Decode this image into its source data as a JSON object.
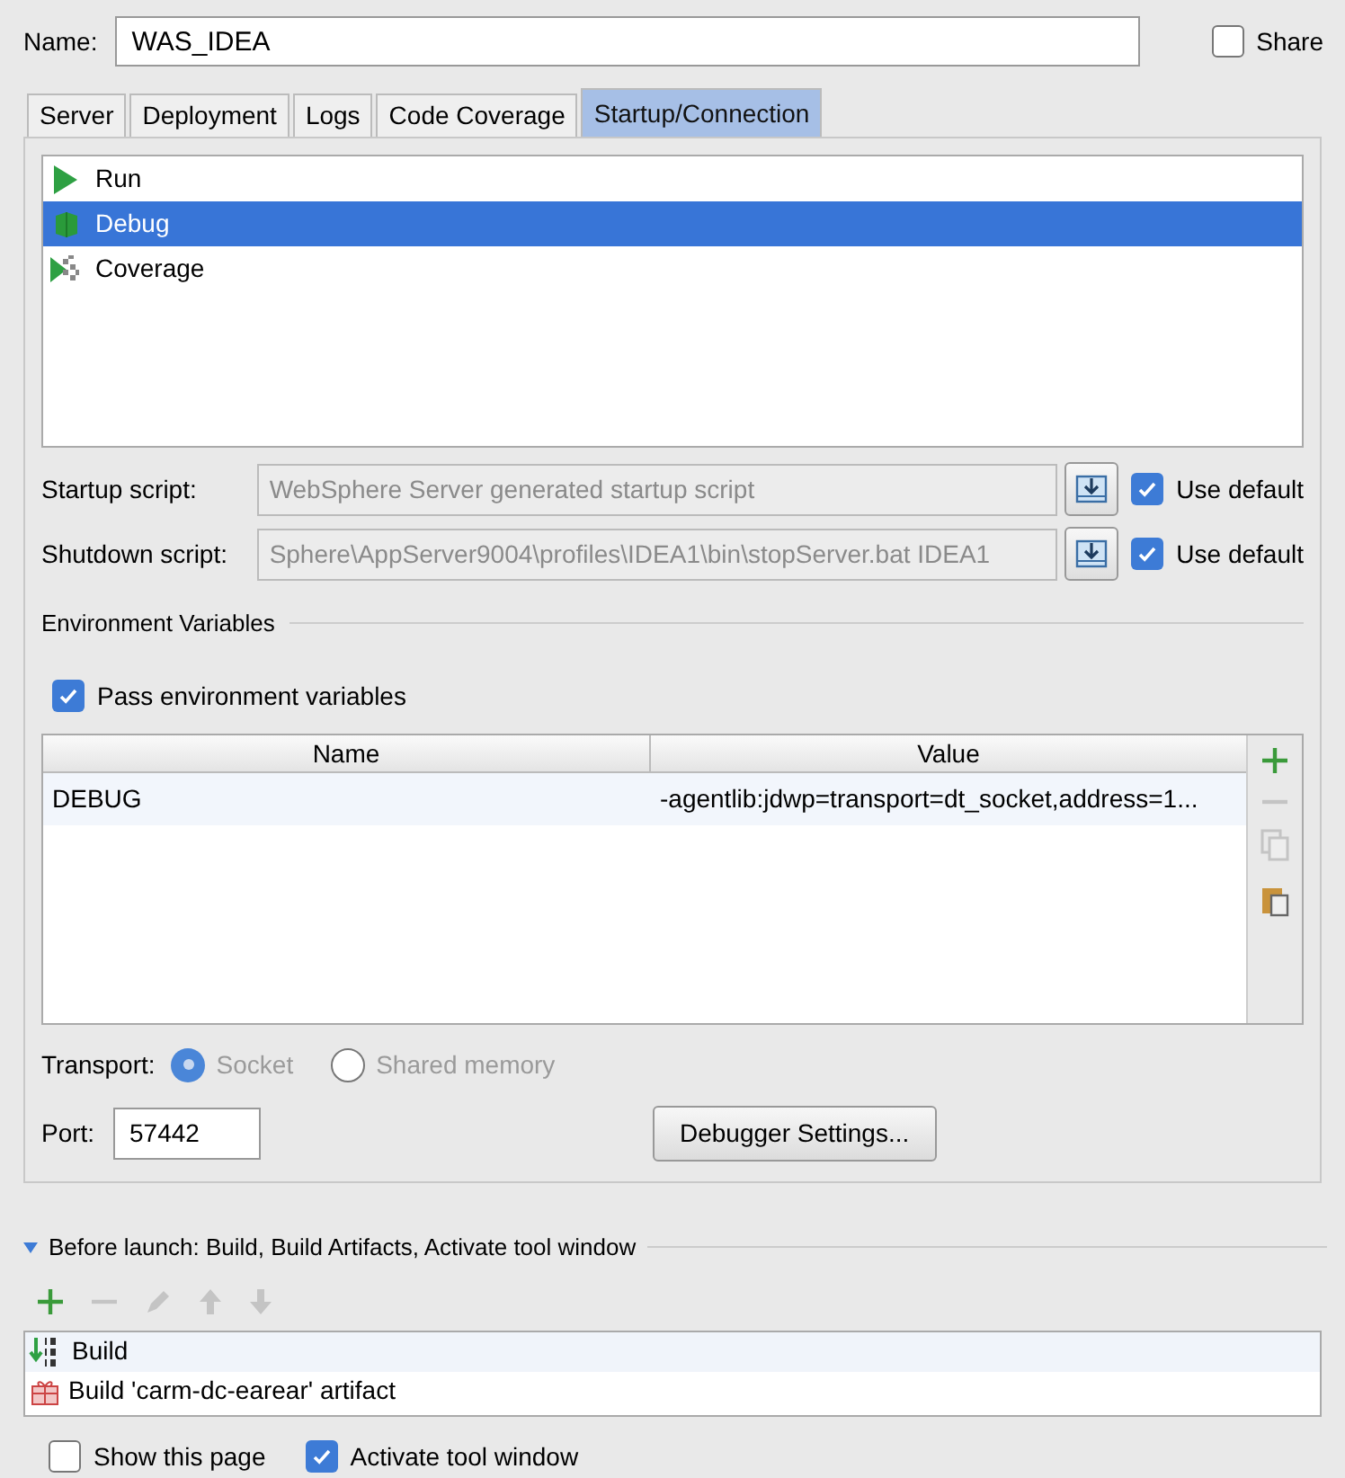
{
  "name_field": {
    "label": "Name:",
    "value": "WAS_IDEA"
  },
  "share": {
    "label": "Share",
    "checked": false
  },
  "tabs": [
    {
      "label": "Server",
      "selected": false
    },
    {
      "label": "Deployment",
      "selected": false
    },
    {
      "label": "Logs",
      "selected": false
    },
    {
      "label": "Code Coverage",
      "selected": false
    },
    {
      "label": "Startup/Connection",
      "selected": true
    }
  ],
  "modes": [
    {
      "kind": "run",
      "label": "Run",
      "selected": false
    },
    {
      "kind": "debug",
      "label": "Debug",
      "selected": true
    },
    {
      "kind": "coverage",
      "label": "Coverage",
      "selected": false
    }
  ],
  "scripts": [
    {
      "label": "Startup script:",
      "value": "WebSphere Server generated startup script",
      "disabled": true,
      "use_default": {
        "label": "Use default",
        "checked": true
      }
    },
    {
      "label": "Shutdown script:",
      "value": "Sphere\\AppServer9004\\profiles\\IDEA1\\bin\\stopServer.bat IDEA1",
      "disabled": true,
      "use_default": {
        "label": "Use default",
        "checked": true
      }
    }
  ],
  "env_section": {
    "title": "Environment Variables",
    "pass": {
      "label": "Pass environment variables",
      "checked": true
    },
    "columns": [
      "Name",
      "Value"
    ],
    "rows": [
      {
        "name": "DEBUG",
        "value": "-agentlib:jdwp=transport=dt_socket,address=1..."
      }
    ],
    "tools": [
      {
        "kind": "add",
        "disabled": false
      },
      {
        "kind": "remove",
        "disabled": true
      },
      {
        "kind": "copy",
        "disabled": true
      },
      {
        "kind": "paste",
        "disabled": false
      }
    ]
  },
  "transport": {
    "label": "Transport:",
    "options": [
      {
        "label": "Socket",
        "selected": true,
        "disabled": true
      },
      {
        "label": "Shared memory",
        "selected": false,
        "disabled": true
      }
    ]
  },
  "port": {
    "label": "Port:",
    "value": "57442"
  },
  "debugger_settings_button": "Debugger Settings...",
  "before_launch": {
    "title": "Before launch: Build, Build Artifacts, Activate tool window",
    "expanded": true,
    "tools": [
      {
        "kind": "add",
        "disabled": false
      },
      {
        "kind": "remove",
        "disabled": true
      },
      {
        "kind": "edit",
        "disabled": true
      },
      {
        "kind": "up",
        "disabled": true
      },
      {
        "kind": "down",
        "disabled": true
      }
    ],
    "items": [
      {
        "kind": "build",
        "label": "Build"
      },
      {
        "kind": "artifact",
        "label": "Build 'carm-dc-earear' artifact"
      }
    ]
  },
  "options": [
    {
      "label": "Show this page",
      "checked": false
    },
    {
      "label": "Activate tool window",
      "checked": true
    }
  ]
}
